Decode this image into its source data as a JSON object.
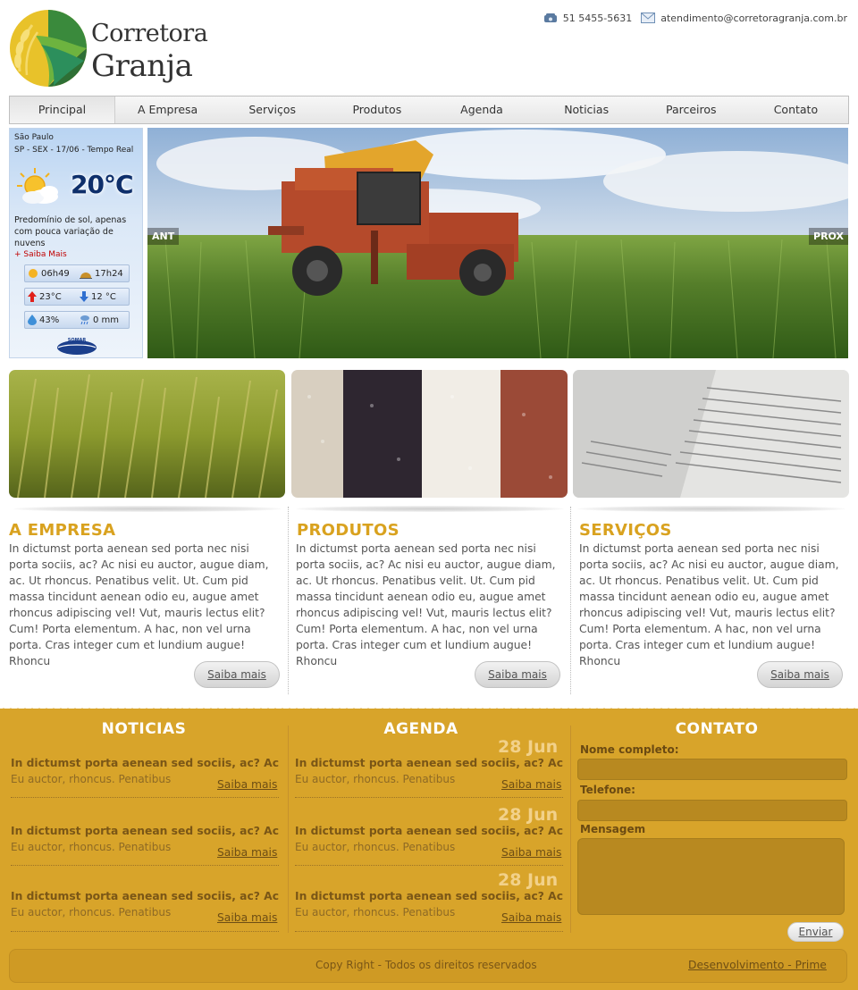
{
  "brand": {
    "line1": "Corretora",
    "line2": "Granja",
    "colors": {
      "yellow": "#d8a42a",
      "title_yellow": "#d9a21f",
      "green": "#2f8a3a"
    }
  },
  "contact_bar": {
    "phone_icon": "phone-icon",
    "phone": "51 5455-5631",
    "email_icon": "mail-icon",
    "email": "atendimento@corretoragranja.com.br"
  },
  "nav": {
    "items": [
      {
        "label": "Principal",
        "active": true
      },
      {
        "label": "A Empresa"
      },
      {
        "label": "Serviços"
      },
      {
        "label": "Produtos"
      },
      {
        "label": "Agenda"
      },
      {
        "label": "Noticias"
      },
      {
        "label": "Parceiros"
      },
      {
        "label": "Contato"
      }
    ]
  },
  "weather": {
    "city": "São Paulo",
    "date_line": "SP - SEX - 17/06 - Tempo Real",
    "temperature": "20°C",
    "condition_icon": "partly-sunny-icon",
    "description": "Predomínio de sol, apenas com pouca variação de nuvens",
    "more": "+ Saiba Mais",
    "sunrise": "06h49",
    "sunset": "17h24",
    "max": "23°C",
    "min": "12 °C",
    "humidity": "43%",
    "rain": "0 mm",
    "provider": "SOMAR"
  },
  "slider": {
    "prev": "ANT",
    "next": "PROX"
  },
  "features": [
    {
      "title": "A EMPRESA",
      "text": "In dictumst porta aenean sed porta nec nisi porta sociis, ac? Ac nisi eu auctor, augue diam, ac. Ut rhoncus. Penatibus velit. Ut. Cum pid massa tincidunt aenean odio eu, augue amet rhoncus adipiscing vel! Vut, mauris lectus elit? Cum! Porta elementum. A hac, non vel urna porta. Cras integer cum et lundium augue! Rhoncu",
      "button": "Saiba mais"
    },
    {
      "title": "PRODUTOS",
      "text": "In dictumst porta aenean sed porta nec nisi porta sociis, ac? Ac nisi eu auctor, augue diam, ac. Ut rhoncus. Penatibus velit. Ut. Cum pid massa tincidunt aenean odio eu, augue amet rhoncus adipiscing vel! Vut, mauris lectus elit? Cum! Porta elementum. A hac, non vel urna porta. Cras integer cum et lundium augue! Rhoncu",
      "button": "Saiba mais"
    },
    {
      "title": "SERVIÇOS",
      "text": "In dictumst porta aenean sed porta nec nisi porta sociis, ac? Ac nisi eu auctor, augue diam, ac. Ut rhoncus. Penatibus velit. Ut. Cum pid massa tincidunt aenean odio eu, augue amet rhoncus adipiscing vel! Vut, mauris lectus elit? Cum! Porta elementum. A hac, non vel urna porta. Cras integer cum et lundium augue! Rhoncu",
      "button": "Saiba mais"
    }
  ],
  "noticias": {
    "title": "NOTICIAS",
    "items": [
      {
        "headline": "In dictumst porta aenean sed sociis, ac? Ac",
        "text": "Eu auctor, rhoncus. Penatibus",
        "more": "Saiba mais"
      },
      {
        "headline": "In dictumst porta aenean sed sociis, ac? Ac",
        "text": "Eu auctor, rhoncus. Penatibus",
        "more": "Saiba mais"
      },
      {
        "headline": "In dictumst porta aenean sed sociis, ac? Ac",
        "text": "Eu auctor, rhoncus. Penatibus",
        "more": "Saiba mais"
      }
    ]
  },
  "agenda": {
    "title": "AGENDA",
    "items": [
      {
        "date": "28 Jun",
        "headline": "In dictumst porta aenean sed sociis, ac? Ac",
        "text": "Eu auctor, rhoncus. Penatibus",
        "more": "Saiba mais"
      },
      {
        "date": "28 Jun",
        "headline": "In dictumst porta aenean sed sociis, ac? Ac",
        "text": "Eu auctor, rhoncus. Penatibus",
        "more": "Saiba mais"
      },
      {
        "date": "28 Jun",
        "headline": "In dictumst porta aenean sed sociis, ac? Ac",
        "text": "Eu auctor, rhoncus. Penatibus",
        "more": "Saiba mais"
      }
    ]
  },
  "contato": {
    "title": "CONTATO",
    "name_label": "Nome completo:",
    "phone_label": "Telefone:",
    "message_label": "Mensagem",
    "send": "Enviar"
  },
  "footer": {
    "copyright": "Copy Right - Todos os direitos reservados",
    "developer": "Desenvolvimento -  Prime"
  }
}
